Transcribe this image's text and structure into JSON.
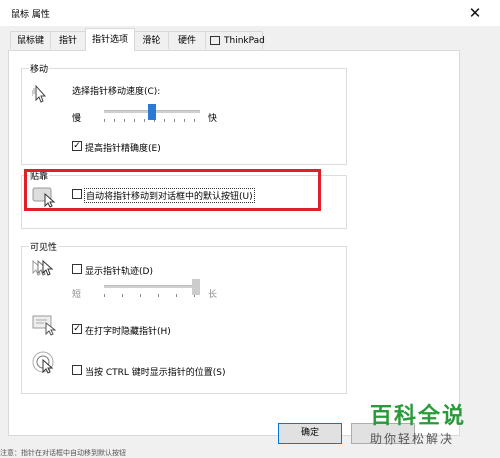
{
  "window": {
    "title": "鼠标 属性",
    "close_glyph": "✕"
  },
  "tabs": [
    {
      "label": "鼠标键"
    },
    {
      "label": "指针"
    },
    {
      "label": "指针选项"
    },
    {
      "label": "滑轮"
    },
    {
      "label": "硬件"
    },
    {
      "label": "ThinkPad"
    }
  ],
  "motion": {
    "group_label": "移动",
    "speed_label": "选择指针移动速度(C):",
    "slow_label": "慢",
    "fast_label": "快",
    "speed_level": 0.5,
    "precision_label": "提高指针精确度(E)",
    "precision_checked": true
  },
  "snap": {
    "group_label": "贴靠",
    "option_label": "自动将指针移动到对话框中的默认按钮(U)",
    "checked": false
  },
  "visibility": {
    "group_label": "可见性",
    "trails_label": "显示指针轨迹(D)",
    "trails_checked": false,
    "short_label": "短",
    "long_label": "长",
    "trail_level": 1.0,
    "hide_label": "在打字时隐藏指针(H)",
    "hide_checked": true,
    "ctrl_label": "当按 CTRL 键时显示指针的位置(S)",
    "ctrl_checked": false
  },
  "buttons": {
    "ok_label": "确定"
  },
  "watermark": {
    "title": "百科全说",
    "subtitle": "助你轻松解决"
  },
  "bottom_text": "注意：指针在对话框中自动移到默认按钮"
}
